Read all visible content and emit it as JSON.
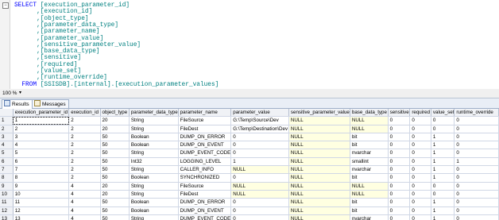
{
  "editor": {
    "lines": [
      {
        "kw": "SELECT",
        "text": " [execution_parameter_id]"
      },
      {
        "kw": "",
        "text": "      ,[execution_id]"
      },
      {
        "kw": "",
        "text": "      ,[object_type]"
      },
      {
        "kw": "",
        "text": "      ,[parameter_data_type]"
      },
      {
        "kw": "",
        "text": "      ,[parameter_name]"
      },
      {
        "kw": "",
        "text": "      ,[parameter_value]"
      },
      {
        "kw": "",
        "text": "      ,[sensitive_parameter_value]"
      },
      {
        "kw": "",
        "text": "      ,[base_data_type]"
      },
      {
        "kw": "",
        "text": "      ,[sensitive]"
      },
      {
        "kw": "",
        "text": "      ,[required]"
      },
      {
        "kw": "",
        "text": "      ,[value_set]"
      },
      {
        "kw": "",
        "text": "      ,[runtime_override]"
      },
      {
        "kw": "  FROM",
        "text": " [SSISDB].[internal].[execution_parameter_values]"
      }
    ],
    "collapse_glyph": "−"
  },
  "zoom": {
    "value": "100 %",
    "caret": "▾"
  },
  "tabs": [
    {
      "label": "Results",
      "active": true
    },
    {
      "label": "Messages",
      "active": false
    }
  ],
  "grid": {
    "columns": [
      "execution_parameter_id",
      "execution_id",
      "object_type",
      "parameter_data_type",
      "parameter_name",
      "parameter_value",
      "sensitive_parameter_value",
      "base_data_type",
      "sensitive",
      "required",
      "value_set",
      "runtime_override"
    ],
    "rows": [
      [
        "1",
        "2",
        "20",
        "String",
        "FileSource",
        "G:\\Temp\\Source\\Dev",
        "NULL",
        "NULL",
        "0",
        "0",
        "0",
        "0"
      ],
      [
        "2",
        "2",
        "20",
        "String",
        "FileDest",
        "G:\\Temp\\Destination\\Dev",
        "NULL",
        "NULL",
        "0",
        "0",
        "0",
        "0"
      ],
      [
        "3",
        "2",
        "50",
        "Boolean",
        "DUMP_ON_ERROR",
        "0",
        "NULL",
        "bit",
        "0",
        "0",
        "1",
        "0"
      ],
      [
        "4",
        "2",
        "50",
        "Boolean",
        "DUMP_ON_EVENT",
        "0",
        "NULL",
        "bit",
        "0",
        "0",
        "1",
        "0"
      ],
      [
        "5",
        "2",
        "50",
        "String",
        "DUMP_EVENT_CODE",
        "0",
        "NULL",
        "nvarchar",
        "0",
        "0",
        "1",
        "0"
      ],
      [
        "6",
        "2",
        "50",
        "Int32",
        "LOGGING_LEVEL",
        "1",
        "NULL",
        "smallint",
        "0",
        "0",
        "1",
        "1"
      ],
      [
        "7",
        "2",
        "50",
        "String",
        "CALLER_INFO",
        "NULL",
        "NULL",
        "nvarchar",
        "0",
        "0",
        "1",
        "0"
      ],
      [
        "8",
        "2",
        "50",
        "Boolean",
        "SYNCHRONIZED",
        "0",
        "NULL",
        "bit",
        "0",
        "0",
        "1",
        "0"
      ],
      [
        "9",
        "4",
        "20",
        "String",
        "FileSource",
        "NULL",
        "NULL",
        "NULL",
        "0",
        "0",
        "0",
        "0"
      ],
      [
        "10",
        "4",
        "20",
        "String",
        "FileDest",
        "NULL",
        "NULL",
        "NULL",
        "0",
        "0",
        "0",
        "0"
      ],
      [
        "11",
        "4",
        "50",
        "Boolean",
        "DUMP_ON_ERROR",
        "0",
        "NULL",
        "bit",
        "0",
        "0",
        "1",
        "0"
      ],
      [
        "12",
        "4",
        "50",
        "Boolean",
        "DUMP_ON_EVENT",
        "0",
        "NULL",
        "bit",
        "0",
        "0",
        "1",
        "0"
      ],
      [
        "13",
        "4",
        "50",
        "String",
        "DUMP_EVENT_CODE",
        "0",
        "NULL",
        "nvarchar",
        "0",
        "0",
        "1",
        "0"
      ]
    ]
  }
}
